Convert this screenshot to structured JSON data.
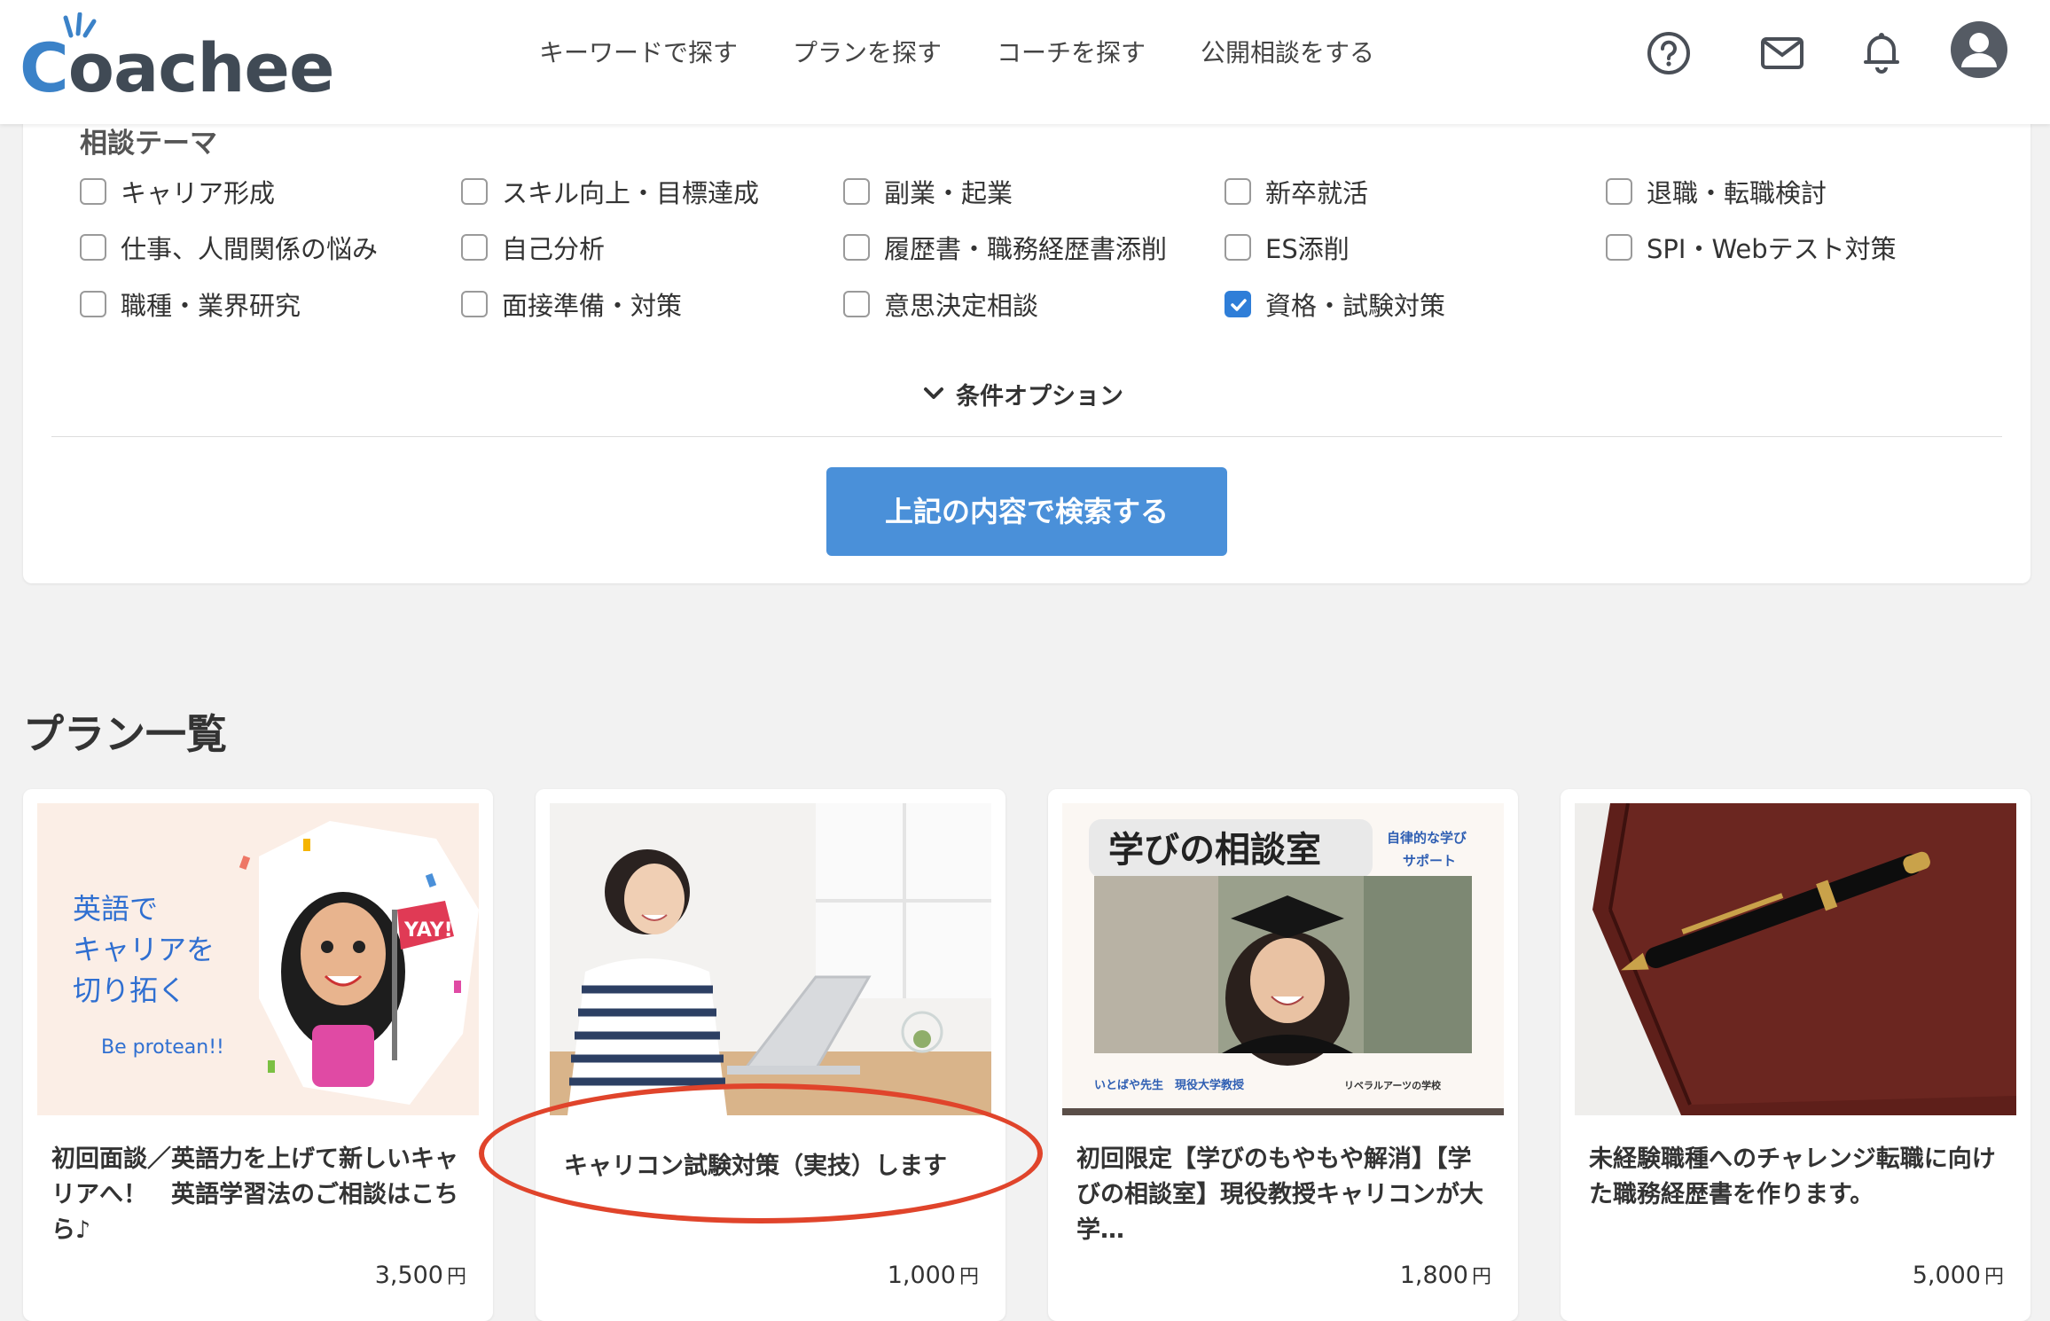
{
  "header": {
    "logo_text": "Coachee",
    "nav": [
      "キーワードで探す",
      "プランを探す",
      "コーチを探す",
      "公開相談をする"
    ],
    "icons": [
      "help-icon",
      "mail-icon",
      "bell-icon",
      "account-icon"
    ]
  },
  "search": {
    "section_label": "相談テーマ",
    "themes": [
      {
        "label": "キャリア形成",
        "checked": false
      },
      {
        "label": "スキル向上・目標達成",
        "checked": false
      },
      {
        "label": "副業・起業",
        "checked": false
      },
      {
        "label": "新卒就活",
        "checked": false
      },
      {
        "label": "退職・転職検討",
        "checked": false
      },
      {
        "label": "仕事、人間関係の悩み",
        "checked": false
      },
      {
        "label": "自己分析",
        "checked": false
      },
      {
        "label": "履歴書・職務経歴書添削",
        "checked": false
      },
      {
        "label": "ES添削",
        "checked": false
      },
      {
        "label": "SPI・Webテスト対策",
        "checked": false
      },
      {
        "label": "職種・業界研究",
        "checked": false
      },
      {
        "label": "面接準備・対策",
        "checked": false
      },
      {
        "label": "意思決定相談",
        "checked": false
      },
      {
        "label": "資格・試験対策",
        "checked": true
      }
    ],
    "options_toggle": "条件オプション",
    "submit_label": "上記の内容で検索する"
  },
  "plans": {
    "title": "プラン一覧",
    "items": [
      {
        "title": "初回面談／英語力を上げて新しいキャリアへ！　英語学習法のご相談はこちら♪",
        "price": "3,500",
        "currency": "円",
        "image_text": [
          "英語で",
          "キャリアを",
          "切り拓く",
          "Be protean!!",
          "YAY!"
        ]
      },
      {
        "title": "キャリコン試験対策（実技）します",
        "price": "1,000",
        "currency": "円",
        "image_text": []
      },
      {
        "title": "初回限定【学びのもやもや解消】【学びの相談室】現役教授キャリコンが大学…",
        "price": "1,800",
        "currency": "円",
        "image_text": [
          "学びの相談室",
          "自律的な学び",
          "サポート",
          "いとばや先生　現役大学教授",
          "リベラルアーツの学校"
        ]
      },
      {
        "title": "未経験職種へのチャレンジ転職に向けた職務経歴書を作ります。",
        "price": "5,000",
        "currency": "円",
        "image_text": []
      }
    ]
  },
  "colors": {
    "accent": "#4a90d9",
    "checkbox_checked": "#2f7ed8",
    "highlight": "#e0442b",
    "logo_c": "#3b82c8"
  }
}
